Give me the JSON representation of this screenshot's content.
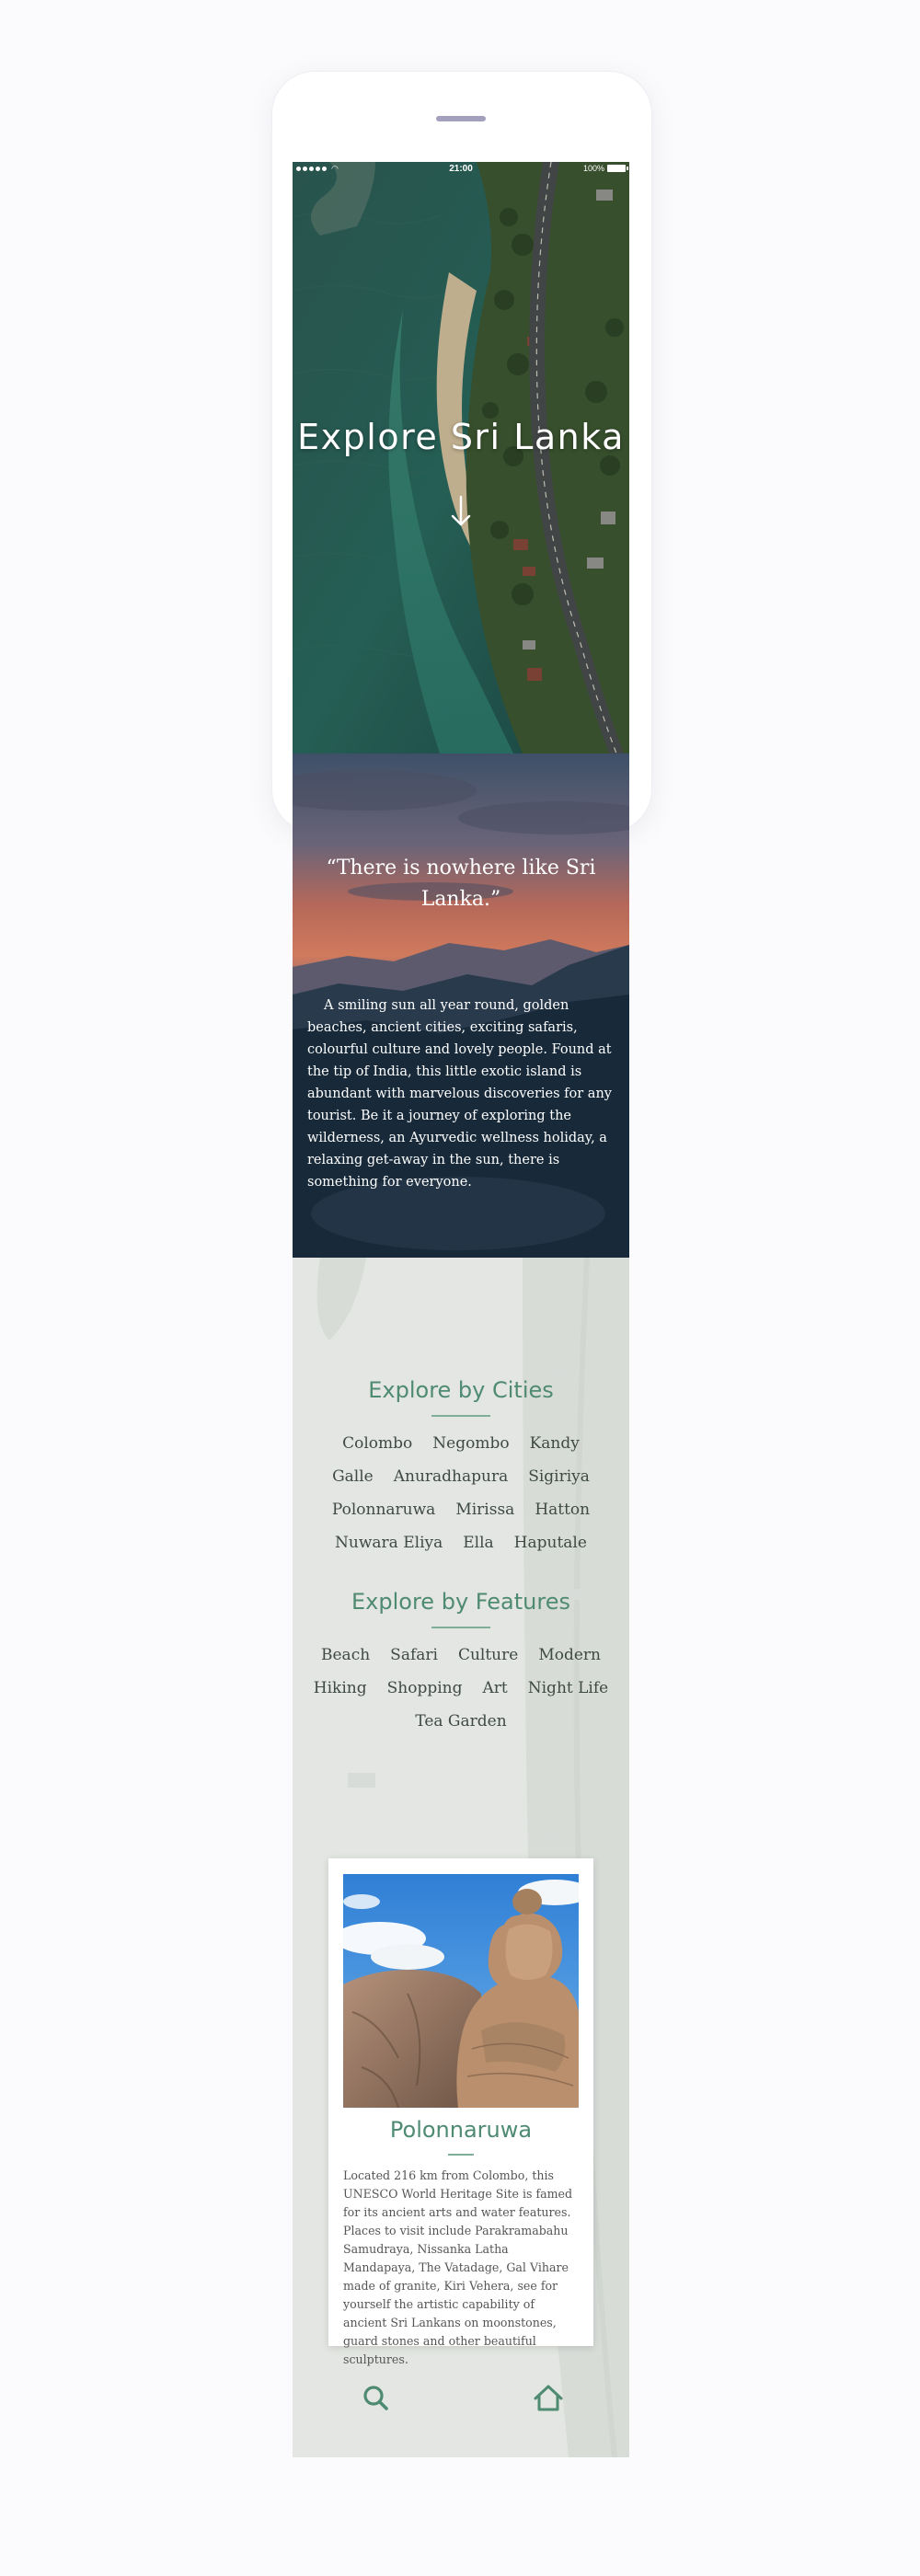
{
  "status_bar": {
    "time": "21:00",
    "battery": "100%"
  },
  "hero": {
    "title": "Explore Sri Lanka",
    "icons": {
      "scroll": "arrow-down-icon"
    }
  },
  "quote": {
    "text": "“There is nowhere like Sri Lanka.”"
  },
  "intro": {
    "text": "A smiling sun all year round, golden beaches, ancient cities, exciting safaris, colourful culture and lovely people. Found at the tip of India, this little exotic island is abundant with marvelous discoveries for any tourist. Be it a journey of exploring the wilderness, an Ayurvedic wellness holiday, a relaxing get-away in the sun, there is something for everyone."
  },
  "cities": {
    "heading": "Explore by Cities",
    "rows": [
      [
        "Colombo",
        "Negombo",
        "Kandy"
      ],
      [
        "Galle",
        "Anuradhapura",
        "Sigiriya"
      ],
      [
        "Polonnaruwa",
        "Mirissa",
        "Hatton"
      ],
      [
        "Nuwara Eliya",
        "Ella",
        "Haputale"
      ]
    ]
  },
  "features": {
    "heading": "Explore by Features",
    "rows": [
      [
        "Beach",
        "Safari",
        "Culture",
        "Modern"
      ],
      [
        "Hiking",
        "Shopping",
        "Art",
        "Night Life"
      ],
      [
        "Tea Garden"
      ]
    ]
  },
  "card": {
    "title": "Polonnaruwa",
    "text": "Located 216 km from Colombo, this UNESCO World Heritage Site is famed for its ancient arts and water features. Places to visit include Parakramabahu Samudraya, Nissanka Latha Mandapaya, The Vatadage, Gal Vihare made of granite, Kiri Vehera, see for yourself the artistic capability of ancient Sri Lankans on moonstones, guard stones and other beautiful sculptures."
  },
  "nav": {
    "search_icon": "search-icon",
    "home_icon": "home-icon"
  },
  "colors": {
    "accent": "#4f8a73",
    "accent_light": "#7fae98",
    "tag_text": "#3f4a44"
  }
}
